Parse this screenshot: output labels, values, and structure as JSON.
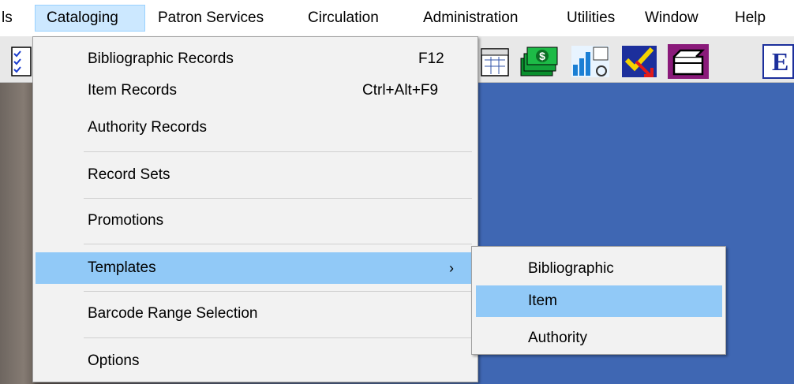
{
  "menubar": {
    "items": [
      {
        "label": "ls"
      },
      {
        "label": "Cataloging"
      },
      {
        "label": "Patron Services"
      },
      {
        "label": "Circulation"
      },
      {
        "label": "Administration"
      },
      {
        "label": "Utilities"
      },
      {
        "label": "Window"
      },
      {
        "label": "Help"
      }
    ]
  },
  "toolbar": {
    "icons": [
      "checklist-icon",
      "calendar-icon",
      "money-icon",
      "graph-icon",
      "checkmark-icon",
      "box-icon",
      "letter-e-icon"
    ],
    "letter_e": "E"
  },
  "cataloging_menu": {
    "items": [
      {
        "label": "Bibliographic Records",
        "shortcut": "F12"
      },
      {
        "label": "Item Records",
        "shortcut": "Ctrl+Alt+F9"
      },
      {
        "label": "Authority Records"
      },
      {
        "label": "Record Sets"
      },
      {
        "label": "Promotions"
      },
      {
        "label": "Templates",
        "arrow": "›"
      },
      {
        "label": "Barcode Range Selection"
      },
      {
        "label": "Options"
      }
    ]
  },
  "templates_submenu": {
    "items": [
      {
        "label": "Bibliographic"
      },
      {
        "label": "Item"
      },
      {
        "label": "Authority"
      }
    ]
  },
  "colors": {
    "highlight": "#91c9f7",
    "menubar_active": "#cce8ff",
    "desktop_blue": "#3f67b3"
  }
}
